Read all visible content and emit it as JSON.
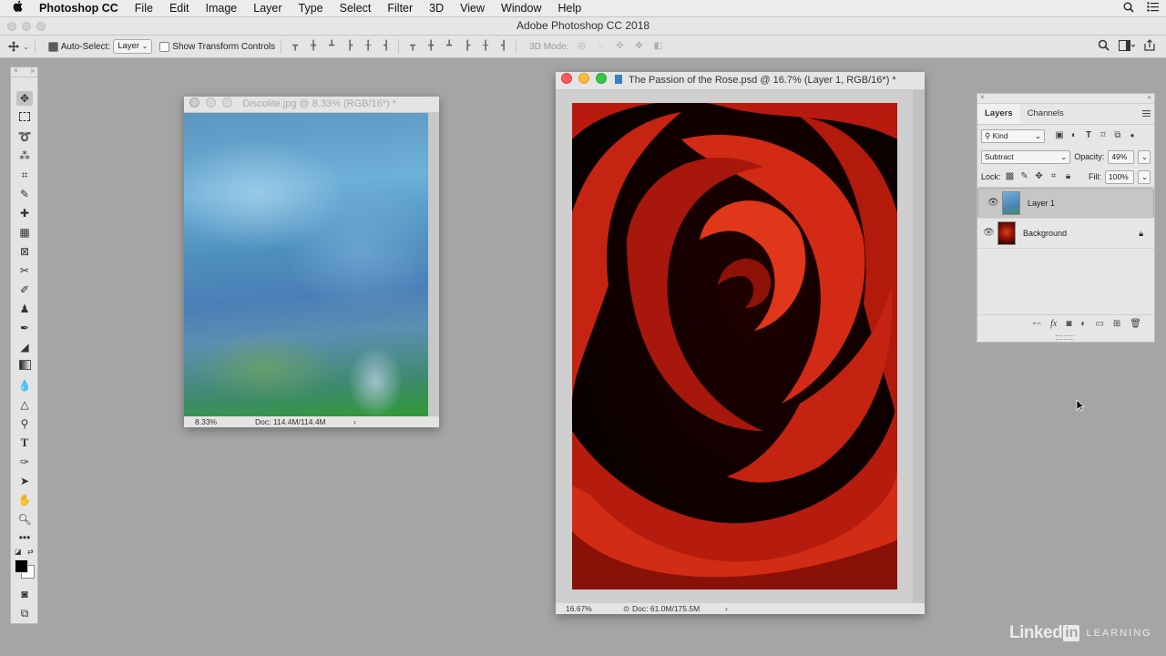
{
  "menubar": {
    "apple": "",
    "app_name": "Photoshop CC",
    "items": [
      "File",
      "Edit",
      "Image",
      "Layer",
      "Type",
      "Select",
      "Filter",
      "3D",
      "View",
      "Window",
      "Help"
    ]
  },
  "window_title": "Adobe Photoshop CC 2018",
  "options": {
    "auto_select_label": "Auto-Select:",
    "auto_select_value": "Layer",
    "show_transform_label": "Show Transform Controls",
    "mode_3d_label": "3D Mode:"
  },
  "doc1": {
    "title": "Discolite.jpg @ 8.33% (RGB/16*) *",
    "zoom": "8.33%",
    "doc_size": "Doc: 114.4M/114.4M"
  },
  "doc2": {
    "title": "The Passion of the Rose.psd @ 16.7% (Layer 1, RGB/16*) *",
    "zoom": "16.67%",
    "doc_size": "Doc: 61.0M/175.5M"
  },
  "layers_panel": {
    "tabs": [
      "Layers",
      "Channels"
    ],
    "kind_label": "Kind",
    "blend_mode": "Subtract",
    "opacity_label": "Opacity:",
    "opacity_value": "49%",
    "lock_label": "Lock:",
    "fill_label": "Fill:",
    "fill_value": "100%",
    "layers": [
      {
        "name": "Layer 1",
        "selected": true
      },
      {
        "name": "Background",
        "selected": false
      }
    ]
  },
  "watermark": {
    "brand_part1": "Linked",
    "brand_part2": "in",
    "brand_part3": "LEARNING"
  }
}
